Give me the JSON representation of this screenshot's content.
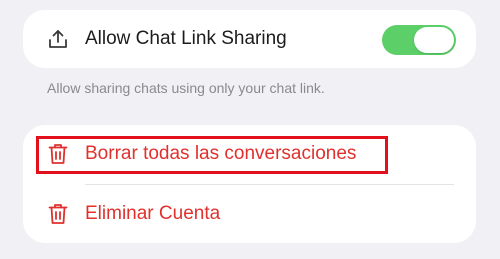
{
  "sharing": {
    "label": "Allow Chat Link Sharing",
    "toggle_on": true,
    "caption": "Allow sharing chats using only your chat link."
  },
  "danger": {
    "items": [
      {
        "label": "Borrar todas las conversaciones",
        "icon": "trash-icon"
      },
      {
        "label": "Eliminar Cuenta",
        "icon": "trash-icon"
      }
    ]
  },
  "colors": {
    "toggle_on": "#5ccf69",
    "destructive": "#e0312e",
    "highlight": "#e2101c"
  }
}
